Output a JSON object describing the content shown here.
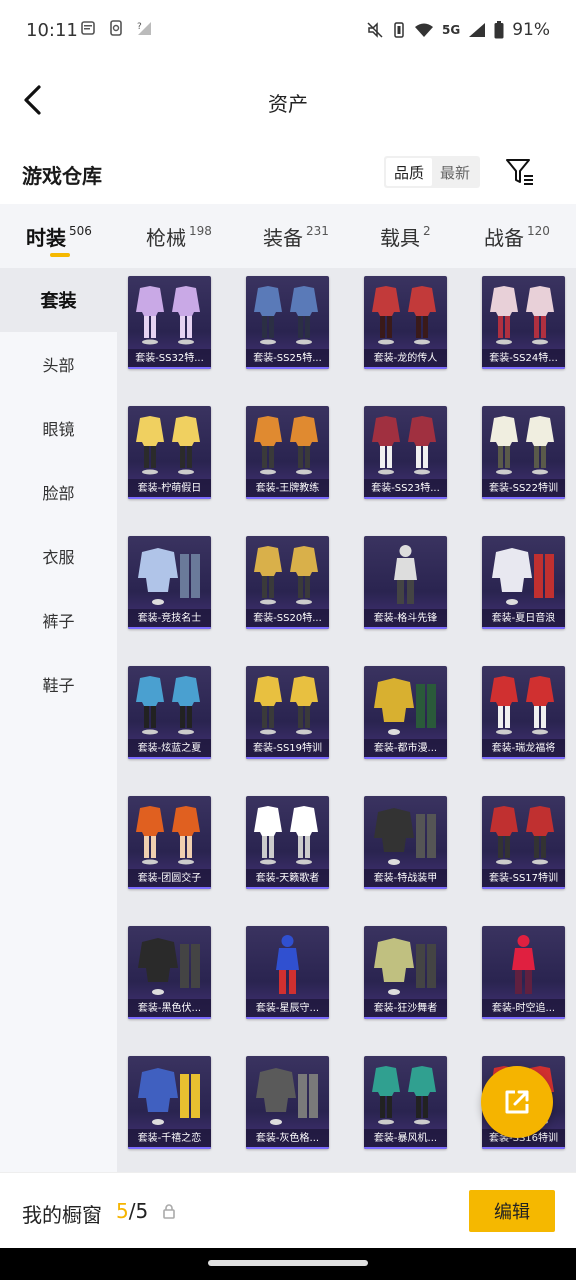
{
  "status_bar": {
    "time": "10:11",
    "network": "5G",
    "battery": "91%",
    "icons": [
      "notification-icon",
      "phone-icon",
      "signal-icon",
      "mute-icon",
      "vibrate-icon",
      "wifi-icon",
      "battery-icon"
    ]
  },
  "header": {
    "title": "资产",
    "back_icon": "chevron-left-icon"
  },
  "warehouse": {
    "title": "游戏仓库",
    "sort_options": [
      "品质",
      "最新"
    ],
    "selected_sort": "品质",
    "filter_icon": "filter-icon"
  },
  "tabs": [
    {
      "label": "时装",
      "count": "506",
      "active": true
    },
    {
      "label": "枪械",
      "count": "198",
      "active": false
    },
    {
      "label": "装备",
      "count": "231",
      "active": false
    },
    {
      "label": "载具",
      "count": "2",
      "active": false
    },
    {
      "label": "战备",
      "count": "120",
      "active": false
    }
  ],
  "side_nav": [
    {
      "label": "套装",
      "active": true
    },
    {
      "label": "头部",
      "active": false
    },
    {
      "label": "眼镜",
      "active": false
    },
    {
      "label": "脸部",
      "active": false
    },
    {
      "label": "衣服",
      "active": false
    },
    {
      "label": "裤子",
      "active": false
    },
    {
      "label": "鞋子",
      "active": false
    }
  ],
  "items": [
    {
      "label": "套装-SS32特...",
      "art": "pair"
    },
    {
      "label": "套装-SS25特...",
      "art": "pair"
    },
    {
      "label": "套装-龙的传人",
      "art": "pair"
    },
    {
      "label": "套装-SS24特...",
      "art": "pair"
    },
    {
      "label": "套装-柠萌假日",
      "art": "pair"
    },
    {
      "label": "套装-王牌教练",
      "art": "pair"
    },
    {
      "label": "套装-SS23特...",
      "art": "pair"
    },
    {
      "label": "套装-SS22特训",
      "art": "pair"
    },
    {
      "label": "套装-竞技名士",
      "art": "jacket"
    },
    {
      "label": "套装-SS20特...",
      "art": "pair"
    },
    {
      "label": "套装-格斗先锋",
      "art": "single"
    },
    {
      "label": "套装-夏日音浪",
      "art": "jacket"
    },
    {
      "label": "套装-炫蓝之夏",
      "art": "pair"
    },
    {
      "label": "套装-SS19特训",
      "art": "pair"
    },
    {
      "label": "套装-都市漫...",
      "art": "jacket"
    },
    {
      "label": "套装-瑞龙福将",
      "art": "pair"
    },
    {
      "label": "套装-团圆交子",
      "art": "pair"
    },
    {
      "label": "套装-天籁歌者",
      "art": "pair"
    },
    {
      "label": "套装-特战装甲",
      "art": "jacket"
    },
    {
      "label": "套装-SS17特训",
      "art": "pair"
    },
    {
      "label": "套装-黑色伏...",
      "art": "jacket"
    },
    {
      "label": "套装-星辰守...",
      "art": "single"
    },
    {
      "label": "套装-狂沙舞者",
      "art": "jacket"
    },
    {
      "label": "套装-时空追...",
      "art": "single"
    },
    {
      "label": "套装-千禧之恋",
      "art": "jacket"
    },
    {
      "label": "套装-灰色格...",
      "art": "jacket"
    },
    {
      "label": "套装-暴风机...",
      "art": "pair"
    },
    {
      "label": "套装-SS16特训",
      "art": "pair"
    }
  ],
  "fab_icon": "share-external-icon",
  "bottom_bar": {
    "my_window_label": "我的橱窗",
    "current": "5",
    "total": "/5",
    "lock_icon": "lock-icon",
    "edit_label": "编辑"
  },
  "colors": {
    "accent": "#f5b800",
    "card_bg": "#2a2450"
  }
}
